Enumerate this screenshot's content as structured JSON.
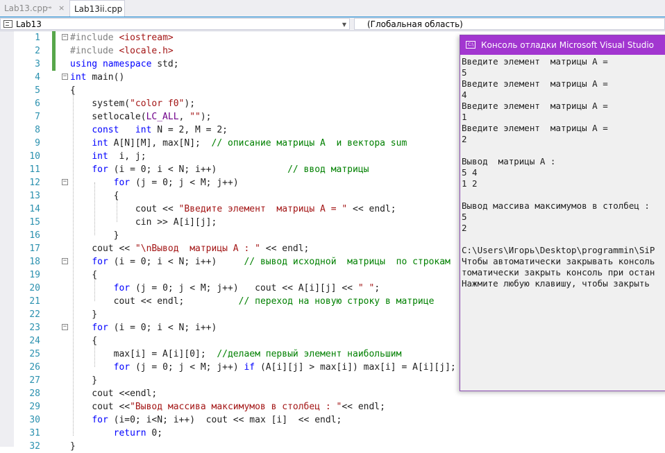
{
  "tabs": [
    {
      "label": "Lab13.cpp"
    },
    {
      "label": "Lab13ii.cpp"
    }
  ],
  "tab_pin_icon": "⊸",
  "tab_close_icon": "×",
  "nav": {
    "project": "Lab13",
    "scope": "(Глобальная область)",
    "dropdown_icon": "▼"
  },
  "code_lines": [
    {
      "n": "1",
      "fold": "−",
      "t": [
        [
          "p",
          "#include "
        ],
        [
          "s",
          "<iostream>"
        ]
      ]
    },
    {
      "n": "2",
      "t": [
        [
          "p",
          "#include "
        ],
        [
          "s",
          "<locale.h>"
        ]
      ]
    },
    {
      "n": "3",
      "t": [
        [
          "k",
          "using namespace "
        ],
        [
          "d",
          "std;"
        ]
      ]
    },
    {
      "n": "4",
      "fold": "−",
      "t": [
        [
          "k",
          "int "
        ],
        [
          "d",
          "main()"
        ]
      ]
    },
    {
      "n": "5",
      "t": [
        [
          "d",
          "{"
        ]
      ]
    },
    {
      "n": "6",
      "t": [
        [
          "d",
          "    system("
        ],
        [
          "s",
          "\"color f0\""
        ],
        [
          "d",
          ");"
        ]
      ]
    },
    {
      "n": "7",
      "t": [
        [
          "d",
          "    setlocale("
        ],
        [
          "m",
          "LC_ALL"
        ],
        [
          "d",
          ", "
        ],
        [
          "s",
          "\"\""
        ],
        [
          "d",
          ");"
        ]
      ]
    },
    {
      "n": "8",
      "t": [
        [
          "d",
          "    "
        ],
        [
          "k",
          "const   int "
        ],
        [
          "d",
          "N = 2, M = 2;"
        ]
      ]
    },
    {
      "n": "9",
      "t": [
        [
          "d",
          "    "
        ],
        [
          "k",
          "int "
        ],
        [
          "d",
          "A[N][M], max[N];  "
        ],
        [
          "c",
          "// описание матрицы А  и вектора sum"
        ]
      ]
    },
    {
      "n": "10",
      "t": [
        [
          "d",
          "    "
        ],
        [
          "k",
          "int  "
        ],
        [
          "d",
          "i, j;"
        ]
      ]
    },
    {
      "n": "11",
      "t": [
        [
          "d",
          "    "
        ],
        [
          "k",
          "for "
        ],
        [
          "d",
          "(i = 0; i < N; i++)             "
        ],
        [
          "c",
          "// ввод матрицы"
        ]
      ]
    },
    {
      "n": "12",
      "fold": "−",
      "t": [
        [
          "d",
          "        "
        ],
        [
          "k",
          "for "
        ],
        [
          "d",
          "(j = 0; j < M; j++)"
        ]
      ]
    },
    {
      "n": "13",
      "t": [
        [
          "d",
          "        {"
        ]
      ]
    },
    {
      "n": "14",
      "t": [
        [
          "d",
          "            cout << "
        ],
        [
          "s",
          "\"Введите элемент  матрицы А = \""
        ],
        [
          "d",
          " << endl;"
        ]
      ]
    },
    {
      "n": "15",
      "t": [
        [
          "d",
          "            cin >> A[i][j];"
        ]
      ]
    },
    {
      "n": "16",
      "t": [
        [
          "d",
          "        }"
        ]
      ]
    },
    {
      "n": "17",
      "t": [
        [
          "d",
          "    cout << "
        ],
        [
          "s",
          "\"\\nВывод  матрицы А : \""
        ],
        [
          "d",
          " << endl;"
        ]
      ]
    },
    {
      "n": "18",
      "fold": "−",
      "t": [
        [
          "d",
          "    "
        ],
        [
          "k",
          "for "
        ],
        [
          "d",
          "(i = 0; i < N; i++)     "
        ],
        [
          "c",
          "// вывод исходной  матрицы  по строкам"
        ]
      ]
    },
    {
      "n": "19",
      "t": [
        [
          "d",
          "    {"
        ]
      ]
    },
    {
      "n": "20",
      "t": [
        [
          "d",
          "        "
        ],
        [
          "k",
          "for "
        ],
        [
          "d",
          "(j = 0; j < M; j++)   cout << A[i][j] << "
        ],
        [
          "s",
          "\" \""
        ],
        [
          "d",
          ";"
        ]
      ]
    },
    {
      "n": "21",
      "t": [
        [
          "d",
          "        cout << endl;          "
        ],
        [
          "c",
          "// переход на новую строку в матрице"
        ]
      ]
    },
    {
      "n": "22",
      "t": [
        [
          "d",
          "    }"
        ]
      ]
    },
    {
      "n": "23",
      "fold": "−",
      "t": [
        [
          "d",
          "    "
        ],
        [
          "k",
          "for "
        ],
        [
          "d",
          "(i = 0; i < N; i++)"
        ]
      ]
    },
    {
      "n": "24",
      "t": [
        [
          "d",
          "    {"
        ]
      ]
    },
    {
      "n": "25",
      "t": [
        [
          "d",
          "        max[i] = A[i][0];  "
        ],
        [
          "c",
          "//делаем первый элемент наибольшим"
        ]
      ]
    },
    {
      "n": "26",
      "t": [
        [
          "d",
          "        "
        ],
        [
          "k",
          "for "
        ],
        [
          "d",
          "(j = 0; j < M; j++) "
        ],
        [
          "k",
          "if "
        ],
        [
          "d",
          "(A[i][j] > max[i]) max[i] = A[i][j];"
        ]
      ]
    },
    {
      "n": "27",
      "t": [
        [
          "d",
          "    }"
        ]
      ]
    },
    {
      "n": "28",
      "t": [
        [
          "d",
          "    cout <<endl;"
        ]
      ]
    },
    {
      "n": "29",
      "t": [
        [
          "d",
          "    cout <<"
        ],
        [
          "s",
          "\"Вывод массива максимумов в столбец : \""
        ],
        [
          "d",
          "<< endl;"
        ]
      ]
    },
    {
      "n": "30",
      "t": [
        [
          "d",
          "    "
        ],
        [
          "k",
          "for "
        ],
        [
          "d",
          "(i=0; i<N; i++)  cout << max [i]  << endl;"
        ]
      ]
    },
    {
      "n": "31",
      "t": [
        [
          "d",
          "        "
        ],
        [
          "k",
          "return "
        ],
        [
          "d",
          "0;"
        ]
      ]
    },
    {
      "n": "32",
      "t": [
        [
          "d",
          "}"
        ]
      ]
    }
  ],
  "console": {
    "icon_label": "C:\\",
    "title": "Консоль отладки Microsoft Visual Studio",
    "lines": [
      "Введите элемент  матрицы А =",
      "5",
      "Введите элемент  матрицы А =",
      "4",
      "Введите элемент  матрицы А =",
      "1",
      "Введите элемент  матрицы А =",
      "2",
      "",
      "Вывод  матрицы А :",
      "5 4",
      "1 2",
      "",
      "Вывод массива максимумов в столбец :",
      "5",
      "2",
      "",
      "C:\\Users\\Игорь\\Desktop\\programmin\\SiP",
      "Чтобы автоматически закрывать консоль",
      "томатически закрыть консоль при остан",
      "Нажмите любую клавишу, чтобы закрыть"
    ]
  },
  "colors": {
    "keyword": "#0000ff",
    "string": "#a31515",
    "comment": "#008000",
    "macro": "#6f008a",
    "line_number": "#2b91af",
    "console_title": "#a236d0"
  }
}
